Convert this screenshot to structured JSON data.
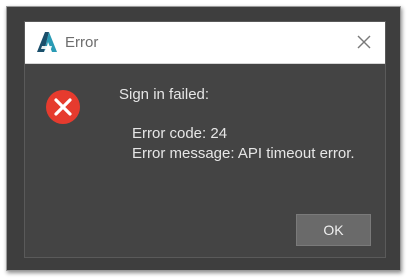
{
  "window": {
    "title": "Error",
    "close_icon": "close-icon",
    "app_icon": "autodesk-a-logo"
  },
  "message": {
    "icon": "error-circle-x-icon",
    "heading": "Sign in failed:",
    "error_code_line": "Error code: 24",
    "error_message_line": "Error message: API timeout error."
  },
  "buttons": {
    "ok_label": "OK"
  },
  "colors": {
    "dialog_bg": "#444444",
    "titlebar_bg": "#ffffff",
    "error_red": "#e63b2e",
    "button_bg": "#6a6a6a",
    "logo_teal": "#0f6e87"
  }
}
